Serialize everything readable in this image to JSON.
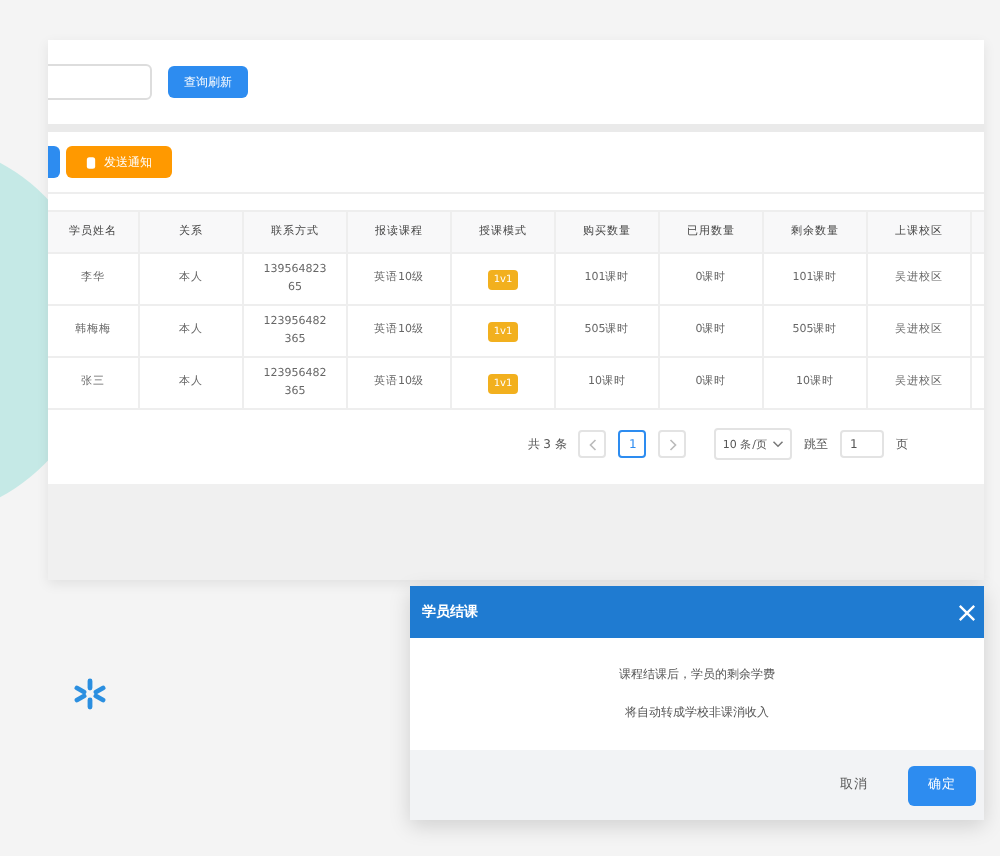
{
  "search": {
    "button": "查询刷新"
  },
  "toolbar": {
    "notify_button": "发送通知"
  },
  "table": {
    "columns": [
      "学员姓名",
      "关系",
      "联系方式",
      "报读课程",
      "授课模式",
      "购买数量",
      "已用数量",
      "剩余数量",
      "上课校区"
    ],
    "rows": [
      {
        "cells": [
          "李华",
          "本人",
          "13956482365",
          "英语10级",
          "1v1",
          "101课时",
          "0课时",
          "101课时",
          "吴进校区"
        ]
      },
      {
        "cells": [
          "韩梅梅",
          "本人",
          "123956482365",
          "英语10级",
          "1v1",
          "505课时",
          "0课时",
          "505课时",
          "吴进校区"
        ]
      },
      {
        "cells": [
          "张三",
          "本人",
          "123956482365",
          "英语10级",
          "1v1",
          "10课时",
          "0课时",
          "10课时",
          "吴进校区"
        ]
      }
    ]
  },
  "pagination": {
    "total": "共 3 条",
    "pages": [
      {
        "label": "1",
        "selected": true
      }
    ],
    "page_size": "10 条/页",
    "jump_label": "跳至",
    "jump_value": "1",
    "page_unit": "页"
  },
  "dialog": {
    "title": "学员结课",
    "lines": [
      "课程结课后，学员的剩余学费",
      "将自动转成学校非课消收入"
    ],
    "cancel": "取消",
    "confirm": "确定"
  }
}
